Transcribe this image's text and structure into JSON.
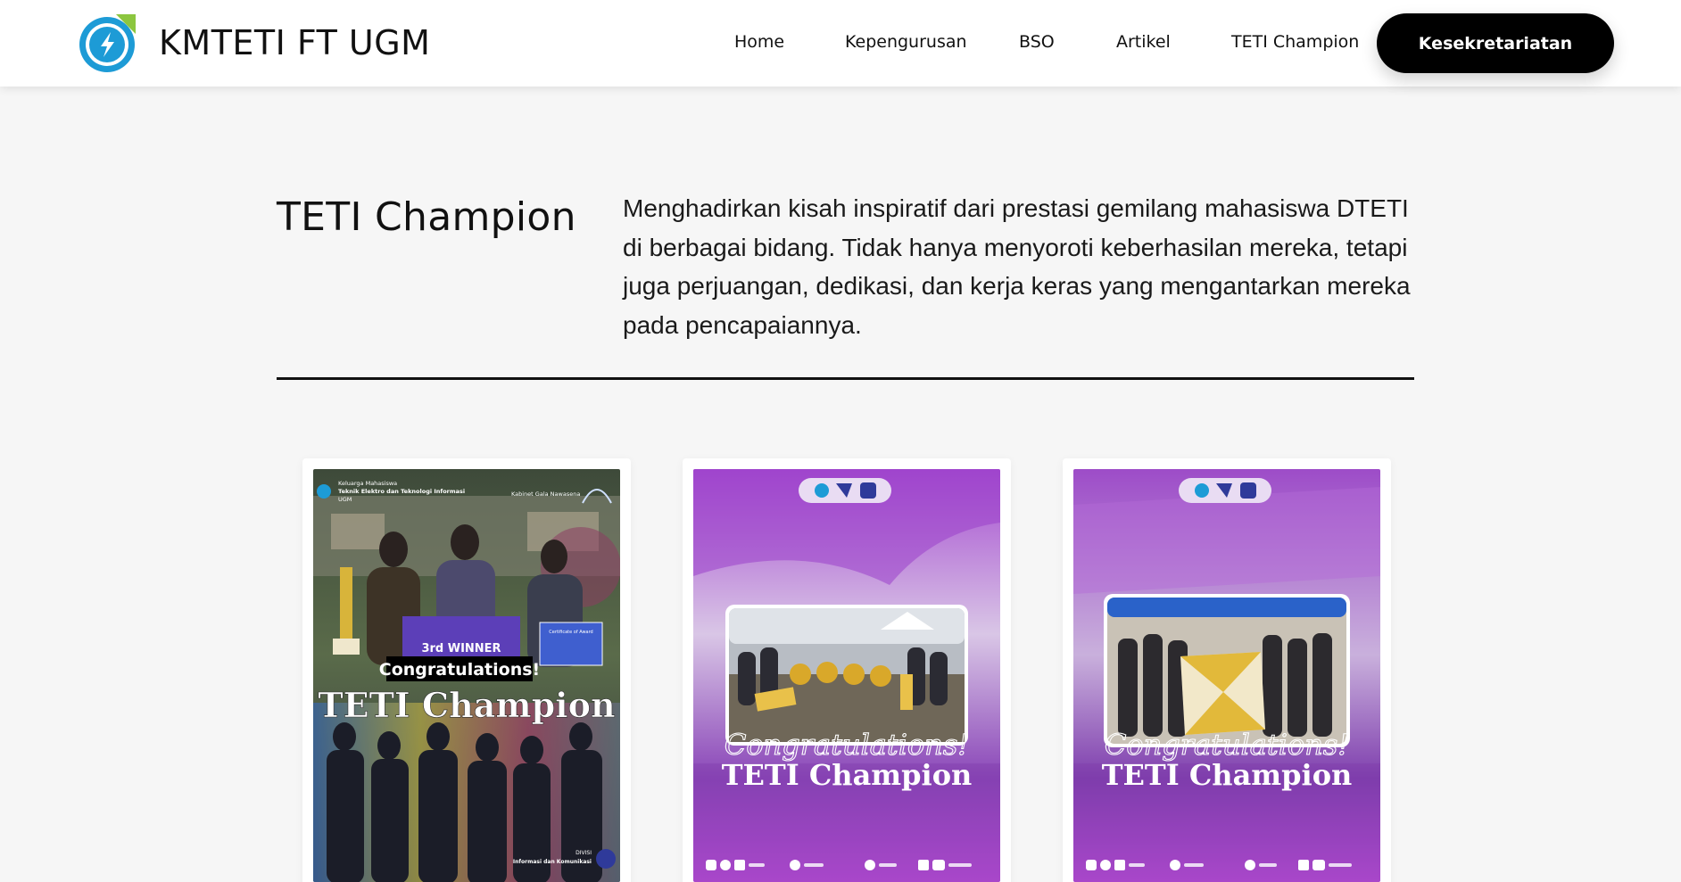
{
  "header": {
    "brand": "KMTETI FT UGM",
    "logo_icon": "kmteti-logo-icon",
    "nav": [
      "Home",
      "Kepengurusan",
      "BSO",
      "Artikel",
      "TETI Champion"
    ],
    "cta_label": "Kesekretariatan",
    "accent": "#1d9bd6"
  },
  "intro": {
    "title": "TETI Champion",
    "description": "Menghadirkan kisah inspiratif dari prestasi gemilang mahasiswa DTETI di berbagai bidang. Tidak hanya menyoroti keberhasilan mereka, tetapi juga perjuangan, dedikasi, dan kerja keras yang mengantarkan mereka pada pencapaiannya."
  },
  "cards": [
    {
      "org_line1": "Keluarga Mahasiswa",
      "org_line2": "Teknik Elektro dan Teknologi Informasi",
      "org_line3": "UGM",
      "cabinet": "Kabinet Gala Nawasena",
      "winner": "3rd WINNER",
      "certificate": "Certificate of Award",
      "congrats": "Congratulations!",
      "title": "TETI Champion",
      "division_line1": "DIVISI",
      "division_line2": "Informasi dan Komunikasi",
      "colors": {
        "primary": "#22324a"
      }
    },
    {
      "congrats": "Congratulations!",
      "title": "TETI Champion",
      "colors": {
        "primary": "#a845c9"
      }
    },
    {
      "congrats": "Congratulations!",
      "title": "TETI Champion",
      "colors": {
        "primary": "#9a4ac3"
      }
    }
  ]
}
